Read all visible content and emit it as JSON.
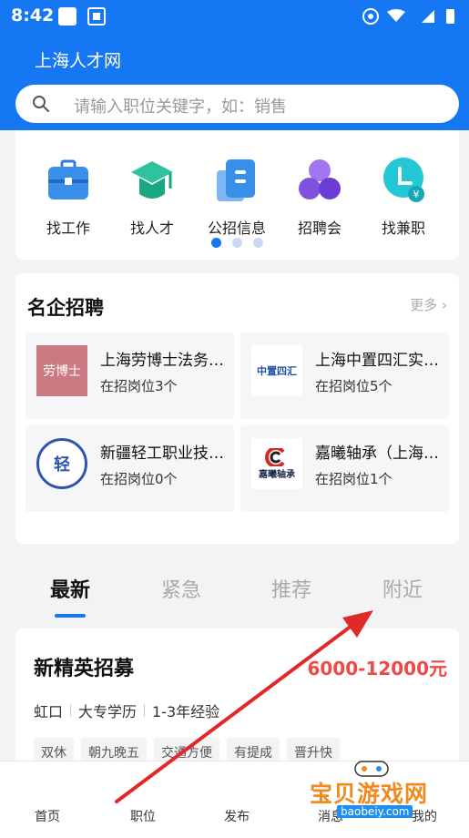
{
  "status_bar": {
    "time": "8:42"
  },
  "header": {
    "title": "上海人才网"
  },
  "search": {
    "placeholder": "请输入职位关键字，如：销售"
  },
  "quick_menu": [
    {
      "label": "找工作",
      "icon": "briefcase-icon"
    },
    {
      "label": "找人才",
      "icon": "graduation-cap-icon"
    },
    {
      "label": "公招信息",
      "icon": "document-icon"
    },
    {
      "label": "招聘会",
      "icon": "group-icon"
    },
    {
      "label": "找兼职",
      "icon": "part-time-icon"
    }
  ],
  "enterprises": {
    "title": "名企招聘",
    "more": "更多",
    "items": [
      {
        "name": "上海劳博士法务咨询有限公司",
        "count": "在招岗位3个",
        "logo_text": "劳博士"
      },
      {
        "name": "上海中置四汇实业有限公司",
        "count": "在招岗位5个",
        "logo_text": "中置四汇"
      },
      {
        "name": "新疆轻工职业技术学院",
        "count": "在招岗位0个",
        "logo_text": "轻"
      },
      {
        "name": "嘉曦轴承（上海）有限公司",
        "count": "在招岗位1个",
        "logo_text": "嘉曦轴承"
      }
    ]
  },
  "tabs": [
    "最新",
    "紧急",
    "推荐",
    "附近"
  ],
  "job": {
    "title": "新精英招募",
    "salary": "6000-12000元",
    "location": "虹口",
    "education": "大专学历",
    "experience": "1-3年经验",
    "tags": [
      "双休",
      "朝九晚五",
      "交通方便",
      "有提成",
      "晋升快"
    ]
  },
  "bottom_nav": [
    "首页",
    "职位",
    "发布",
    "消息",
    "我的"
  ],
  "watermark": {
    "text": "宝贝游戏网",
    "url": "baobeiy.com"
  },
  "colors": {
    "primary": "#1677f2",
    "salary": "#f04848",
    "watermark": "#f08a1e"
  }
}
